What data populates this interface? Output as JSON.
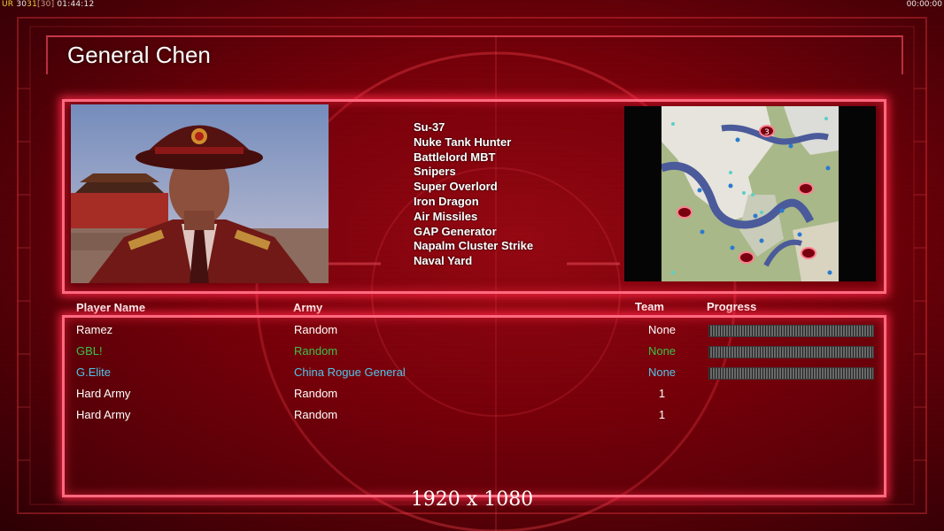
{
  "hud": {
    "prefix": "UR",
    "fps_a": "30",
    "fps_b": "31",
    "fps_c": "[30]",
    "clock": "01:44:12",
    "timer": "00:00:00"
  },
  "general": {
    "name": "General Chen"
  },
  "units": [
    "Su-37",
    "Nuke Tank Hunter",
    "Battlelord MBT",
    "Snipers",
    "Super Overlord",
    "Iron Dragon",
    "Air Missiles",
    "GAP Generator",
    "Napalm Cluster Strike",
    "Naval Yard"
  ],
  "map": {
    "marker_label": "3"
  },
  "columns": {
    "player": "Player Name",
    "army": "Army",
    "team": "Team",
    "progress": "Progress"
  },
  "players": [
    {
      "name": "Ramez",
      "army": "Random",
      "team": "None",
      "color": "#ffffff",
      "has_progress": true
    },
    {
      "name": "GBL!",
      "army": "Random",
      "team": "None",
      "color": "#39c24a",
      "has_progress": true
    },
    {
      "name": "G.Elite",
      "army": "China Rogue General",
      "team": "None",
      "color": "#4fc6ea",
      "has_progress": true
    },
    {
      "name": "Hard Army",
      "army": "Random",
      "team": "1",
      "color": "#ffffff",
      "has_progress": false
    },
    {
      "name": "Hard Army",
      "army": "Random",
      "team": "1",
      "color": "#ffffff",
      "has_progress": false
    }
  ],
  "resolution_label": "1920 x 1080",
  "colors": {
    "panel_border": "#ff6a80",
    "background": "#6a0008"
  }
}
